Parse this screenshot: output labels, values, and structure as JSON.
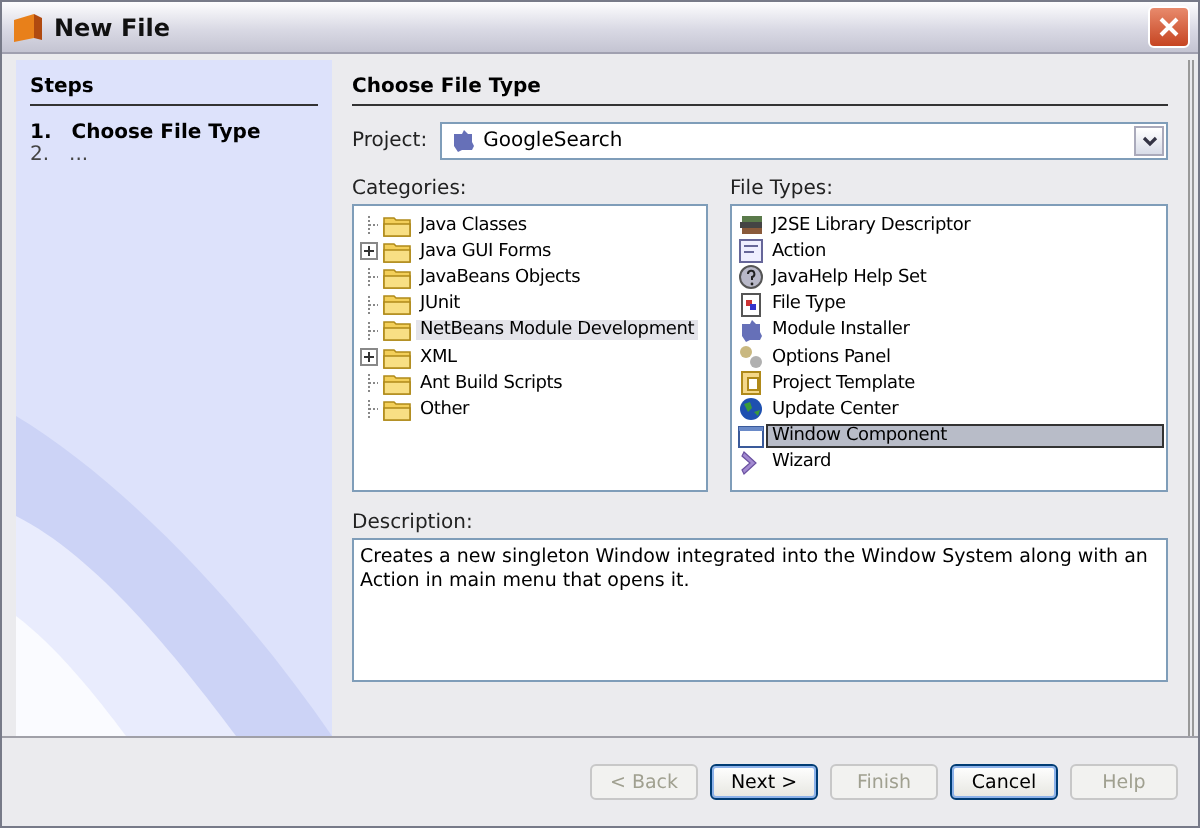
{
  "window": {
    "title": "New File"
  },
  "steps": {
    "title": "Steps",
    "items": [
      {
        "number": "1.",
        "label": "Choose File Type",
        "selected": true
      },
      {
        "number": "2.",
        "label": "...",
        "selected": false
      }
    ]
  },
  "panel_title": "Choose File Type",
  "project": {
    "label": "Project:",
    "value": "GoogleSearch"
  },
  "categories": {
    "label": "Categories:",
    "items": [
      {
        "label": "Java Classes",
        "expandable": false,
        "selected": false
      },
      {
        "label": "Java GUI Forms",
        "expandable": true,
        "selected": false
      },
      {
        "label": "JavaBeans Objects",
        "expandable": false,
        "selected": false
      },
      {
        "label": "JUnit",
        "expandable": false,
        "selected": false
      },
      {
        "label": "NetBeans Module Development",
        "expandable": false,
        "selected": true
      },
      {
        "label": "XML",
        "expandable": true,
        "selected": false
      },
      {
        "label": "Ant Build Scripts",
        "expandable": false,
        "selected": false
      },
      {
        "label": "Other",
        "expandable": false,
        "selected": false
      }
    ]
  },
  "file_types": {
    "label": "File Types:",
    "items": [
      {
        "label": "J2SE Library Descriptor",
        "selected": false
      },
      {
        "label": "Action",
        "selected": false
      },
      {
        "label": "JavaHelp Help Set",
        "selected": false
      },
      {
        "label": "File Type",
        "selected": false
      },
      {
        "label": "Module Installer",
        "selected": false
      },
      {
        "label": "Options Panel",
        "selected": false
      },
      {
        "label": "Project Template",
        "selected": false
      },
      {
        "label": "Update Center",
        "selected": false
      },
      {
        "label": "Window Component",
        "selected": true
      },
      {
        "label": "Wizard",
        "selected": false
      }
    ]
  },
  "description": {
    "label": "Description:",
    "text": "Creates a new singleton Window integrated into the Window System along with an Action in main menu that opens it."
  },
  "buttons": [
    {
      "label": "< Back",
      "disabled": true,
      "focused": false
    },
    {
      "label": "Next >",
      "disabled": false,
      "focused": true
    },
    {
      "label": "Finish",
      "disabled": true,
      "focused": false
    },
    {
      "label": "Cancel",
      "disabled": false,
      "focused": true
    },
    {
      "label": "Help",
      "disabled": true,
      "focused": false
    }
  ]
}
